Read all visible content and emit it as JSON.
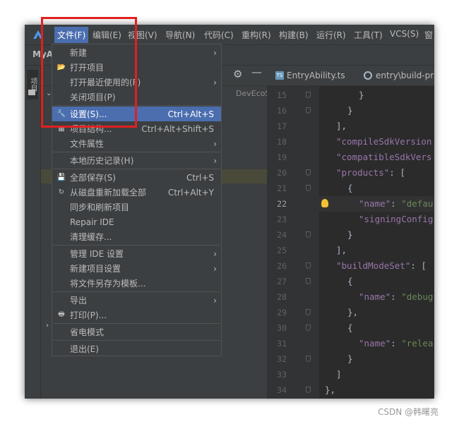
{
  "menubar": {
    "items": [
      "文件(F)",
      "编辑(E)",
      "视图(V)",
      "导航(N)",
      "代码(C)",
      "重构(R)",
      "构建(B)",
      "运行(R)",
      "工具(T)",
      "VCS(S)",
      "窗"
    ]
  },
  "navbar": {
    "project": "MyA"
  },
  "left_strip": {
    "label": "项目"
  },
  "project_panel": {
    "tree_fragment": "DevEcoStud"
  },
  "tabs": [
    {
      "label": "EntryAbility.ts",
      "icon": "ts-file-icon"
    },
    {
      "label": "entry\\build-pr",
      "icon": "config-file-icon"
    }
  ],
  "file_menu": {
    "items": [
      {
        "label": "新建",
        "icon": "",
        "shortcut": "",
        "submenu": true
      },
      {
        "label": "打开项目",
        "icon": "folder-open-icon",
        "shortcut": "",
        "submenu": false
      },
      {
        "label": "打开最近使用的(F)",
        "icon": "",
        "shortcut": "",
        "submenu": true
      },
      {
        "label": "关闭项目(P)",
        "icon": "",
        "shortcut": "",
        "submenu": false
      },
      {
        "label": "设置(S)...",
        "icon": "wrench-icon",
        "shortcut": "Ctrl+Alt+S",
        "submenu": false,
        "selected": true
      },
      {
        "label": "项目结构...",
        "icon": "project-structure-icon",
        "shortcut": "Ctrl+Alt+Shift+S",
        "submenu": false
      },
      {
        "label": "文件属性",
        "icon": "",
        "shortcut": "",
        "submenu": true
      },
      {
        "label": "本地历史记录(H)",
        "icon": "",
        "shortcut": "",
        "submenu": true
      },
      {
        "label": "全部保存(S)",
        "icon": "save-icon",
        "shortcut": "Ctrl+S",
        "submenu": false
      },
      {
        "label": "从磁盘重新加载全部",
        "icon": "reload-icon",
        "shortcut": "Ctrl+Alt+Y",
        "submenu": false
      },
      {
        "label": "同步和刷新项目",
        "icon": "",
        "shortcut": "",
        "submenu": false
      },
      {
        "label": "Repair IDE",
        "icon": "",
        "shortcut": "",
        "submenu": false
      },
      {
        "label": "清理缓存...",
        "icon": "",
        "shortcut": "",
        "submenu": false
      },
      {
        "label": "管理 IDE 设置",
        "icon": "",
        "shortcut": "",
        "submenu": true
      },
      {
        "label": "新建项目设置",
        "icon": "",
        "shortcut": "",
        "submenu": true
      },
      {
        "label": "将文件另存为模板...",
        "icon": "",
        "shortcut": "",
        "submenu": false
      },
      {
        "label": "导出",
        "icon": "",
        "shortcut": "",
        "submenu": true
      },
      {
        "label": "打印(P)...",
        "icon": "print-icon",
        "shortcut": "",
        "submenu": false
      },
      {
        "label": "省电模式",
        "icon": "",
        "shortcut": "",
        "submenu": false
      },
      {
        "label": "退出(E)",
        "icon": "",
        "shortcut": "",
        "submenu": false
      }
    ]
  },
  "editor": {
    "current_line": 22,
    "lines": [
      {
        "num": "15",
        "code": "}"
      },
      {
        "num": "16",
        "code": "}"
      },
      {
        "num": "17",
        "code": "],"
      },
      {
        "num": "18",
        "code": "\"compileSdkVersion"
      },
      {
        "num": "19",
        "code": "\"compatibleSdkVers"
      },
      {
        "num": "20",
        "code": "\"products\": ["
      },
      {
        "num": "21",
        "code": "{"
      },
      {
        "num": "22",
        "code": "\"name\": \"defau"
      },
      {
        "num": "23",
        "code": "\"signingConfig"
      },
      {
        "num": "24",
        "code": "}"
      },
      {
        "num": "25",
        "code": "],"
      },
      {
        "num": "26",
        "code": "\"buildModeSet\": ["
      },
      {
        "num": "27",
        "code": "{"
      },
      {
        "num": "28",
        "code": "\"name\": \"debug"
      },
      {
        "num": "29",
        "code": "},"
      },
      {
        "num": "30",
        "code": "{"
      },
      {
        "num": "31",
        "code": "\"name\": \"relea"
      },
      {
        "num": "32",
        "code": "}"
      },
      {
        "num": "33",
        "code": "]"
      },
      {
        "num": "34",
        "code": "},"
      }
    ]
  },
  "watermark": "CSDN @韩曙亮",
  "colors": {
    "menu_bg": "#3c3f41",
    "selection": "#4b6eaf",
    "editor_bg": "#2b2b2b",
    "key_color": "#9876aa",
    "string_color": "#6a8759",
    "highlight_box": "#e0201e"
  }
}
